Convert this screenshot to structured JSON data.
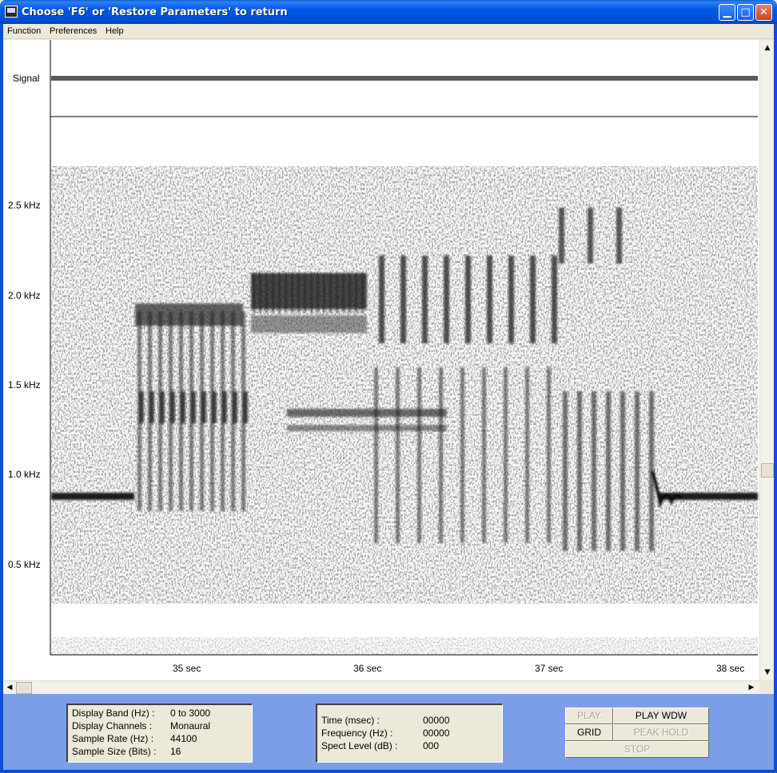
{
  "window": {
    "title": "Choose 'F6' or 'Restore Parameters' to return",
    "controls": {
      "minimize": "▁",
      "maximize": "□",
      "close": "✕"
    }
  },
  "menu": [
    "Function",
    "Preferences",
    "Help"
  ],
  "plot": {
    "signal_label": "Signal",
    "freq_labels": [
      "2.5 kHz",
      "2.0 kHz",
      "1.5 kHz",
      "1.0 kHz",
      "0.5 kHz"
    ],
    "time_labels": [
      "35  sec",
      "36  sec",
      "37  sec",
      "38  sec"
    ]
  },
  "display_info": {
    "rows": [
      {
        "label": "Display Band (Hz) :",
        "value": "0 to 3000"
      },
      {
        "label": "Display Channels :",
        "value": "Monaural"
      },
      {
        "label": "Sample Rate (Hz) :",
        "value": "44100"
      },
      {
        "label": "Sample Size (Bits) :",
        "value": "16"
      }
    ]
  },
  "cursor_info": {
    "rows": [
      {
        "label": "Time (msec) :",
        "value": "00000"
      },
      {
        "label": "Frequency (Hz) :",
        "value": "00000"
      },
      {
        "label": "Spect Level (dB) :",
        "value": "000"
      }
    ]
  },
  "buttons": {
    "play": "PLAY",
    "play_wdw": "PLAY WDW",
    "grid": "GRID",
    "peak_hold": "PEAK HOLD",
    "stop": "STOP"
  }
}
